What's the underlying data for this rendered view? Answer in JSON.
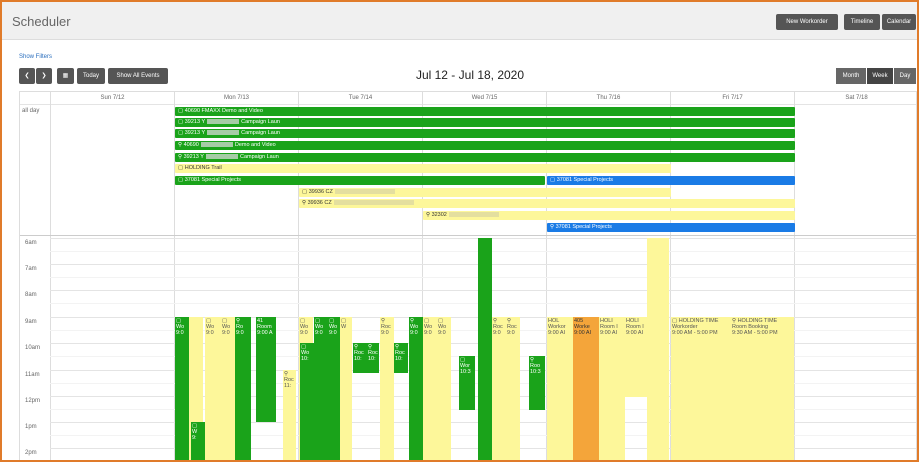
{
  "app": {
    "title": "Scheduler",
    "buttons": {
      "new_workorder": "New Workorder",
      "timeline": "Timeline",
      "calendar": "Calendar"
    }
  },
  "toolbar": {
    "show_filters": "Show Filters",
    "prev_icon": "chevron-left-icon",
    "next_icon": "chevron-right-icon",
    "calendar_icon": "calendar-icon",
    "today": "Today",
    "show_all_events": "Show All Events",
    "date_range": "Jul 12 - Jul 18, 2020",
    "views": {
      "month": "Month",
      "week": "Week",
      "day": "Day"
    },
    "active_view": "Week"
  },
  "calendar": {
    "allday_label": "all day",
    "days": [
      "Sun 7/12",
      "Mon 7/13",
      "Tue 7/14",
      "Wed 7/15",
      "Thu 7/16",
      "Fri 7/17",
      "Sat 7/18"
    ],
    "hours": [
      "6am",
      "7am",
      "8am",
      "9am",
      "10am",
      "11am",
      "12pm",
      "1pm",
      "2pm"
    ],
    "colors": {
      "green": "#1aa31a",
      "blue": "#1a7be6",
      "yellow": "#fdf79a",
      "orange": "#f4a53a"
    },
    "allday_events": [
      {
        "label": "40690 FMAXX Demo and Video",
        "color": "green"
      },
      {
        "label": "39213 Y",
        "label2": "Campaign Laun",
        "color": "green"
      },
      {
        "label": "39213 Y",
        "label2": "Campaign Laun",
        "color": "green"
      },
      {
        "label": "40690",
        "label2": "Demo and Video",
        "color": "green"
      },
      {
        "label": "39213 Y",
        "label2": "Campaign Laun",
        "color": "green"
      },
      {
        "label": "HOLDING Trail",
        "color": "yellow"
      },
      {
        "label": "37081 Special Projects",
        "color": "green"
      },
      {
        "label": "37081 Special Projects",
        "color": "blue"
      },
      {
        "label": "39936 CZ",
        "color": "yellow"
      },
      {
        "label": "39936 CZ",
        "color": "yellow"
      },
      {
        "label": "32302",
        "color": "yellow"
      },
      {
        "label": "37081 Special Projects",
        "color": "blue"
      }
    ],
    "timed_events": {
      "thu_1": {
        "title": "HOL",
        "sub": "Workor",
        "time": "9:00 AI"
      },
      "thu_2": {
        "title": "405",
        "sub": "Worke",
        "time": "9:00 AI"
      },
      "thu_3": {
        "title": "HOLI",
        "sub": "Room I",
        "time": "9:00 AI"
      },
      "thu_4": {
        "title": "HOLI",
        "sub": "Room I",
        "time": "9:00 AI"
      },
      "fri_1": {
        "title": "HOLDING TIME",
        "sub": "Workorder",
        "time": "9:00 AM - 5:00 PM"
      },
      "fri_2": {
        "title": "HOLDING TIME",
        "sub": "Room Booking",
        "time": "9:30 AM - 5:00 PM"
      },
      "mon_a": {
        "title": "41",
        "sub": "Room",
        "time": "9:00 A"
      },
      "tue_a": {
        "title": "Wo",
        "sub": "Wo",
        "time": "9:0"
      },
      "wed_a": {
        "title": "Wo",
        "sub": "Wo",
        "time": "9:0"
      }
    }
  }
}
